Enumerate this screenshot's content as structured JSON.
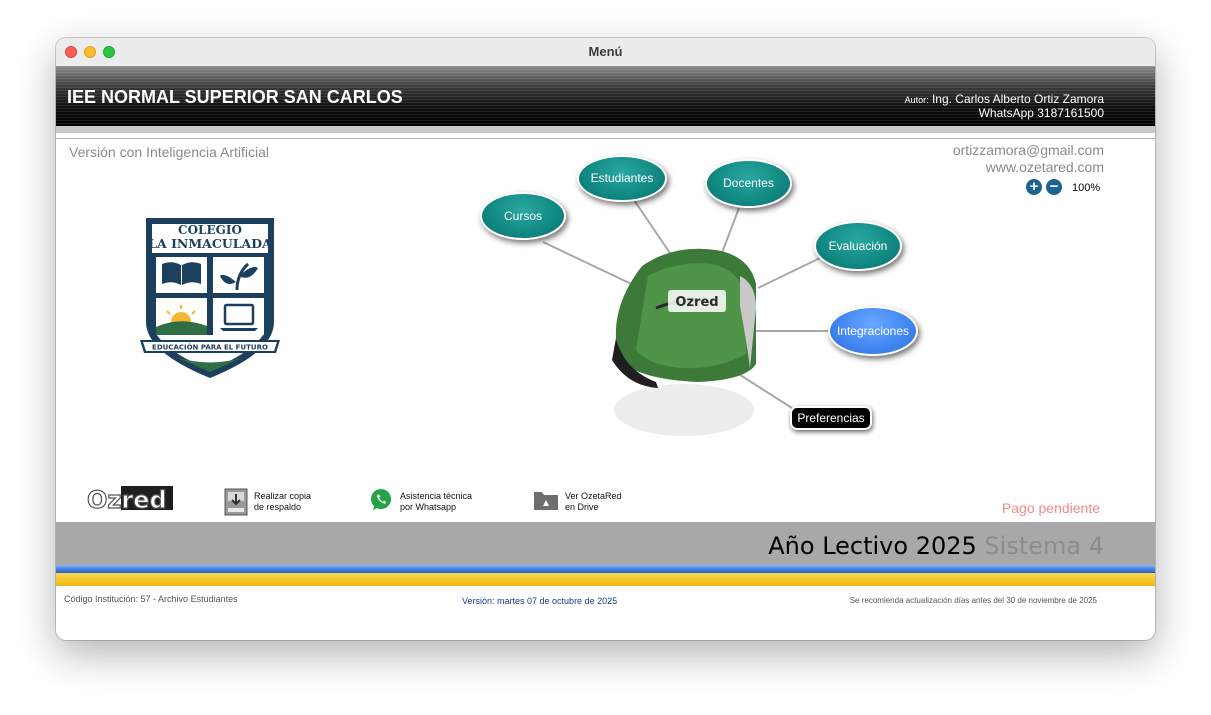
{
  "window": {
    "title": "Menú"
  },
  "header": {
    "school": "IEE NORMAL SUPERIOR SAN CARLOS",
    "autor_prefix": "Autor:",
    "autor_name": "Ing. Carlos Alberto Ortiz Zamora",
    "whatsapp": "WhatsApp 3187161500"
  },
  "info": {
    "version_ia": "Versión con Inteligencia Artificial",
    "email": "ortizzamora@gmail.com",
    "website": "www.ozetared.com",
    "zoom_level": "100%",
    "zoom_in_icon": "plus-circle-icon",
    "zoom_out_icon": "minus-circle-icon"
  },
  "logo": {
    "line1": "COLEGIO",
    "line2": "LA INMACULADA",
    "banner": "EDUCACIÓN PARA EL FUTURO",
    "colors": {
      "navy": "#1b3f5c",
      "green": "#2f6e45",
      "sun": "#f4b731"
    }
  },
  "menu": {
    "cursos": "Cursos",
    "estudiantes": "Estudiantes",
    "docentes": "Docentes",
    "evaluacion": "Evaluación",
    "integraciones": "Integraciones",
    "preferencias": "Preferencias",
    "center_brand": "Ozred"
  },
  "tools": {
    "brand": "Ozred",
    "backup": {
      "line1": "Realizar copia",
      "line2": "de respaldo",
      "icon": "backup-icon"
    },
    "whatsapp": {
      "line1": "Asistencia técnica",
      "line2": "por Whatsapp",
      "icon": "whatsapp-icon"
    },
    "drive": {
      "line1": "Ver OzetaRed",
      "line2": "en Drive",
      "icon": "drive-folder-icon"
    }
  },
  "status": {
    "pago": "Pago pendiente",
    "year_label": "Año Lectivo 2025",
    "system_label": "Sistema 4"
  },
  "footer": {
    "left": "Código Institución: 57 - Archivo Estudiantes",
    "center": "Versión: martes 07 de octubre de 2025",
    "right": "Se recomienda actualización días antes del  30 de noviembre de 2025"
  },
  "colors": {
    "teal": "#118882",
    "blue": "#3f85f0",
    "pending": "#f08a8a",
    "year_bar": "#a8a8a8",
    "stripe_yellow": "#f4c623"
  }
}
